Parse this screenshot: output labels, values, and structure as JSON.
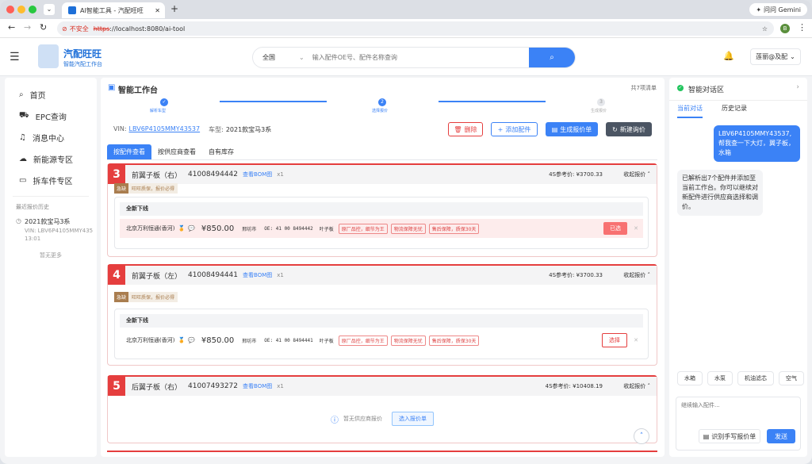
{
  "browser": {
    "tab_title": "AI智能工具 - 汽配旺旺",
    "new_tab": "+",
    "url_warning": "不安全",
    "url_scheme": "https",
    "url_rest": "://localhost:8080/ai-tool",
    "gemini": "问问 Gemini",
    "profile": "B"
  },
  "header": {
    "brand": "汽配旺旺",
    "brand_sub": "智能汽配工作台",
    "region": "全国",
    "search_placeholder": "输入配件OE号、配件名称查询",
    "store": "莲丽@及配"
  },
  "sidebar": {
    "items": [
      {
        "label": "首页",
        "icon": "search-icon"
      },
      {
        "label": "EPC查询",
        "icon": "truck-icon"
      },
      {
        "label": "消息中心",
        "icon": "bell-icon"
      },
      {
        "label": "新能源专区",
        "icon": "cloud-icon"
      },
      {
        "label": "拆车件专区",
        "icon": "box-icon"
      }
    ],
    "history_title": "最近报价历史",
    "history": [
      {
        "title": "2021款宝马3系",
        "vin": "VIN: LBV6P4105MMY435",
        "time": "13:01"
      }
    ],
    "more": "暂无更多"
  },
  "main": {
    "title": "智能工作台",
    "count": "共7项清单",
    "steps": [
      "解析车型",
      "选择报价",
      "生成报价"
    ],
    "vin_label": "VIN:",
    "vin": "LBV6P4105MMY43537",
    "model_label": "车型:",
    "model": "2021款宝马3系",
    "actions": {
      "delete": "删除",
      "add": "添加配件",
      "generate": "生成报价单",
      "new": "新建询价"
    },
    "tabs": [
      "按配件查看",
      "按供应商查看",
      "自有库存"
    ],
    "parts": [
      {
        "no": "3",
        "name": "前翼子板（右）",
        "oe": "41008494442",
        "bom": "查看BOM图",
        "qty": "x1",
        "ref": "4S参考价: ¥3700.33",
        "collapse": "收起报价 ˄",
        "badge": "急缺",
        "hint": "旺旺质保，报价必得",
        "section": "全新下线",
        "supplier": "北京万利恒通(香河)",
        "price": "¥850.00",
        "city": "邢坊市",
        "oe_line": "OE: 41 00 8494442",
        "pname": "叶子板",
        "tags": [
          "原厂品控，细节为王",
          "物流保障无忧",
          "售后保障，质保30天"
        ],
        "action": "已选",
        "selected": true
      },
      {
        "no": "4",
        "name": "前翼子板（左）",
        "oe": "41008494441",
        "bom": "查看BOM图",
        "qty": "x1",
        "ref": "4S参考价: ¥3700.33",
        "collapse": "收起报价 ˄",
        "badge": "急缺",
        "hint": "旺旺质保，报价必得",
        "section": "全新下线",
        "supplier": "北京万利恒通(香河)",
        "price": "¥850.00",
        "city": "邢坊市",
        "oe_line": "OE: 41 00 8494441",
        "pname": "叶子板",
        "tags": [
          "原厂品控，细节为王",
          "物流保障无忧",
          "售后保障，质保30天"
        ],
        "action": "选择",
        "selected": false
      },
      {
        "no": "5",
        "name": "后翼子板（右）",
        "oe": "41007493272",
        "bom": "查看BOM图",
        "qty": "x1",
        "ref": "4S参考价: ¥10408.19",
        "collapse": "收起报价 ˄",
        "empty": "暂无供应商报价",
        "empty_action": "选入报价单"
      }
    ]
  },
  "chat": {
    "title": "智能对话区",
    "tabs": [
      "当前对话",
      "历史记录"
    ],
    "user_msg": "LBV6P4105MMY43537, 帮我查一下大灯，翼子板，水箱",
    "bot_msg": "已解析出7个配件并添加至当前工作台。你可以继续对新配件进行供应商选择和调价。",
    "chips": [
      "水箱",
      "水泵",
      "机油滤芯",
      "空气"
    ],
    "input_placeholder": "继续输入配件...",
    "ocr": "识别手写报价单",
    "send": "发送"
  },
  "colors": {
    "accent": "#3b82f6",
    "danger": "#e53e3e",
    "brand": "#1d6fd8"
  }
}
